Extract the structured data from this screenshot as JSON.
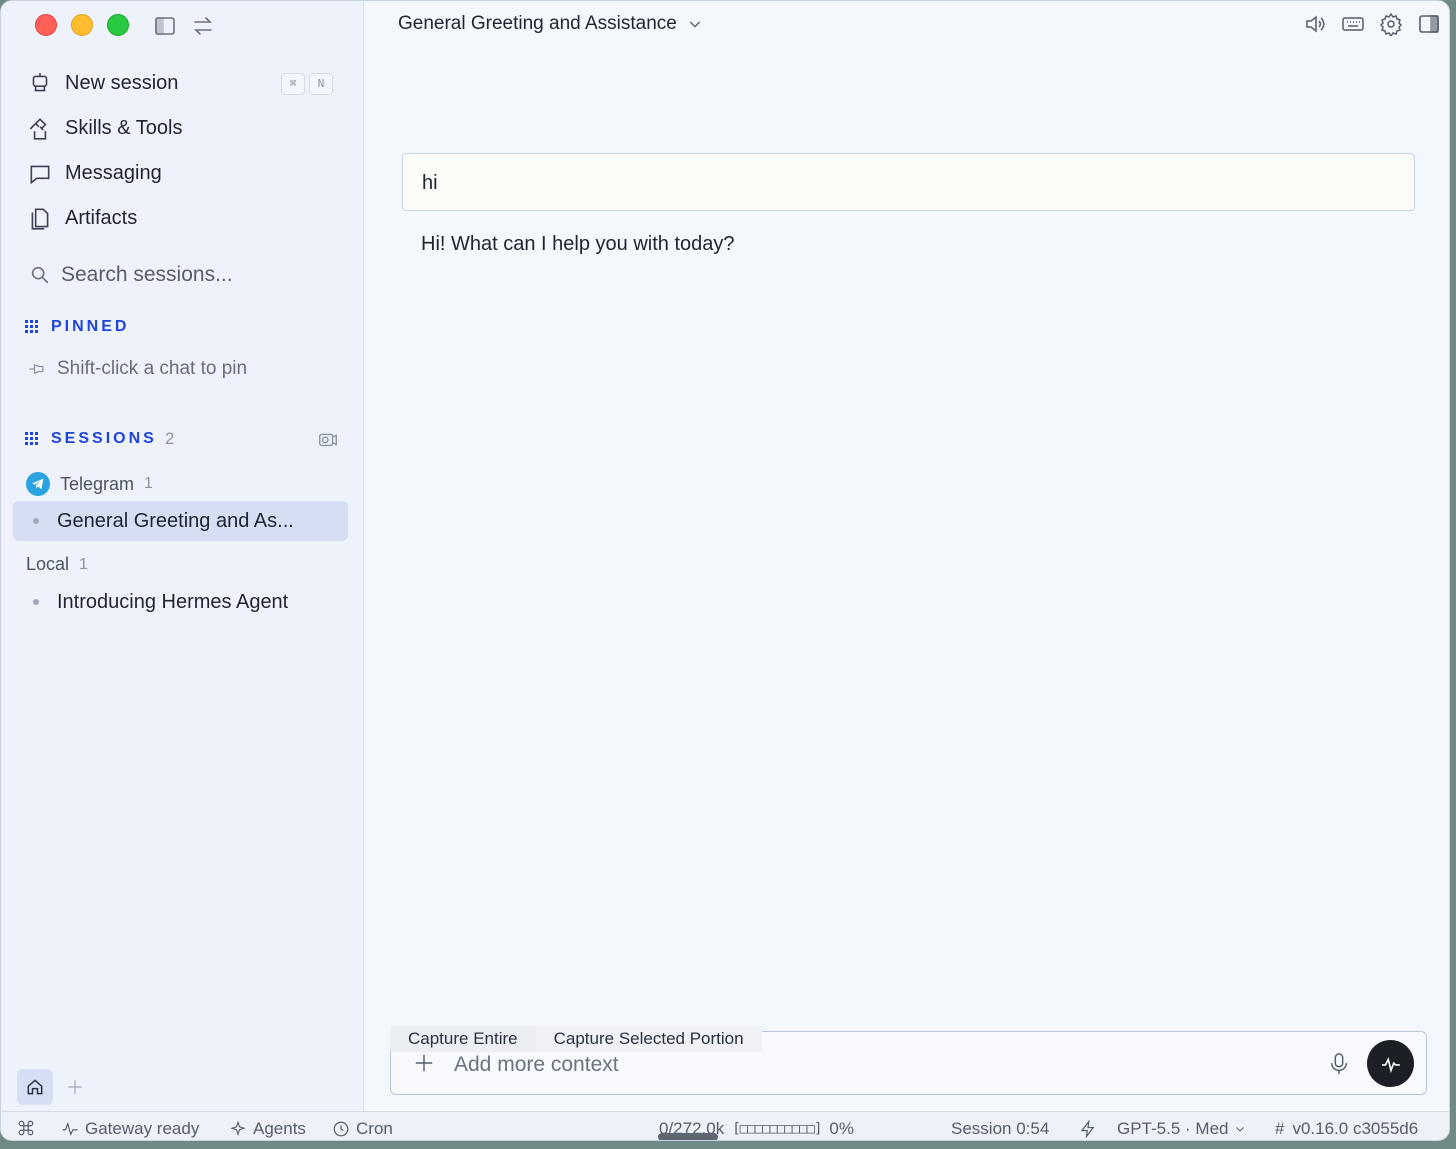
{
  "sidebar": {
    "nav": [
      {
        "label": "New session",
        "icon": "robot-icon",
        "shortcut": [
          "⌘",
          "N"
        ]
      },
      {
        "label": "Skills & Tools",
        "icon": "tools-icon"
      },
      {
        "label": "Messaging",
        "icon": "chat-bubble-icon"
      },
      {
        "label": "Artifacts",
        "icon": "documents-icon"
      }
    ],
    "search_placeholder": "Search sessions...",
    "pinned": {
      "title": "PINNED",
      "hint": "Shift-click a chat to pin"
    },
    "sessions": {
      "title": "SESSIONS",
      "count": "2",
      "groups": [
        {
          "name": "Telegram",
          "count": "1",
          "items": [
            "General Greeting and As..."
          ]
        },
        {
          "name": "Local",
          "count": "1",
          "items": [
            "Introducing Hermes Agent"
          ]
        }
      ]
    }
  },
  "main": {
    "title": "General Greeting and Assistance",
    "messages": {
      "user": "hi",
      "assistant": "Hi! What can I help you with today?"
    },
    "capture": {
      "entire": "Capture Entire",
      "selected": "Capture Selected Portion"
    },
    "composer_placeholder": "Add more context"
  },
  "statusbar": {
    "gateway": "Gateway ready",
    "agents": "Agents",
    "cron": "Cron",
    "context": "0/272.0k",
    "context_bar": "[□□□□□□□□□□]",
    "context_pct": "0%",
    "session": "Session 0:54",
    "model": "GPT-5.5 · Med",
    "version": "v0.16.0 c3055d6"
  },
  "colors": {
    "accent": "#1f44d8",
    "active_row": "#d5def3",
    "send_button": "#1c1f26"
  }
}
